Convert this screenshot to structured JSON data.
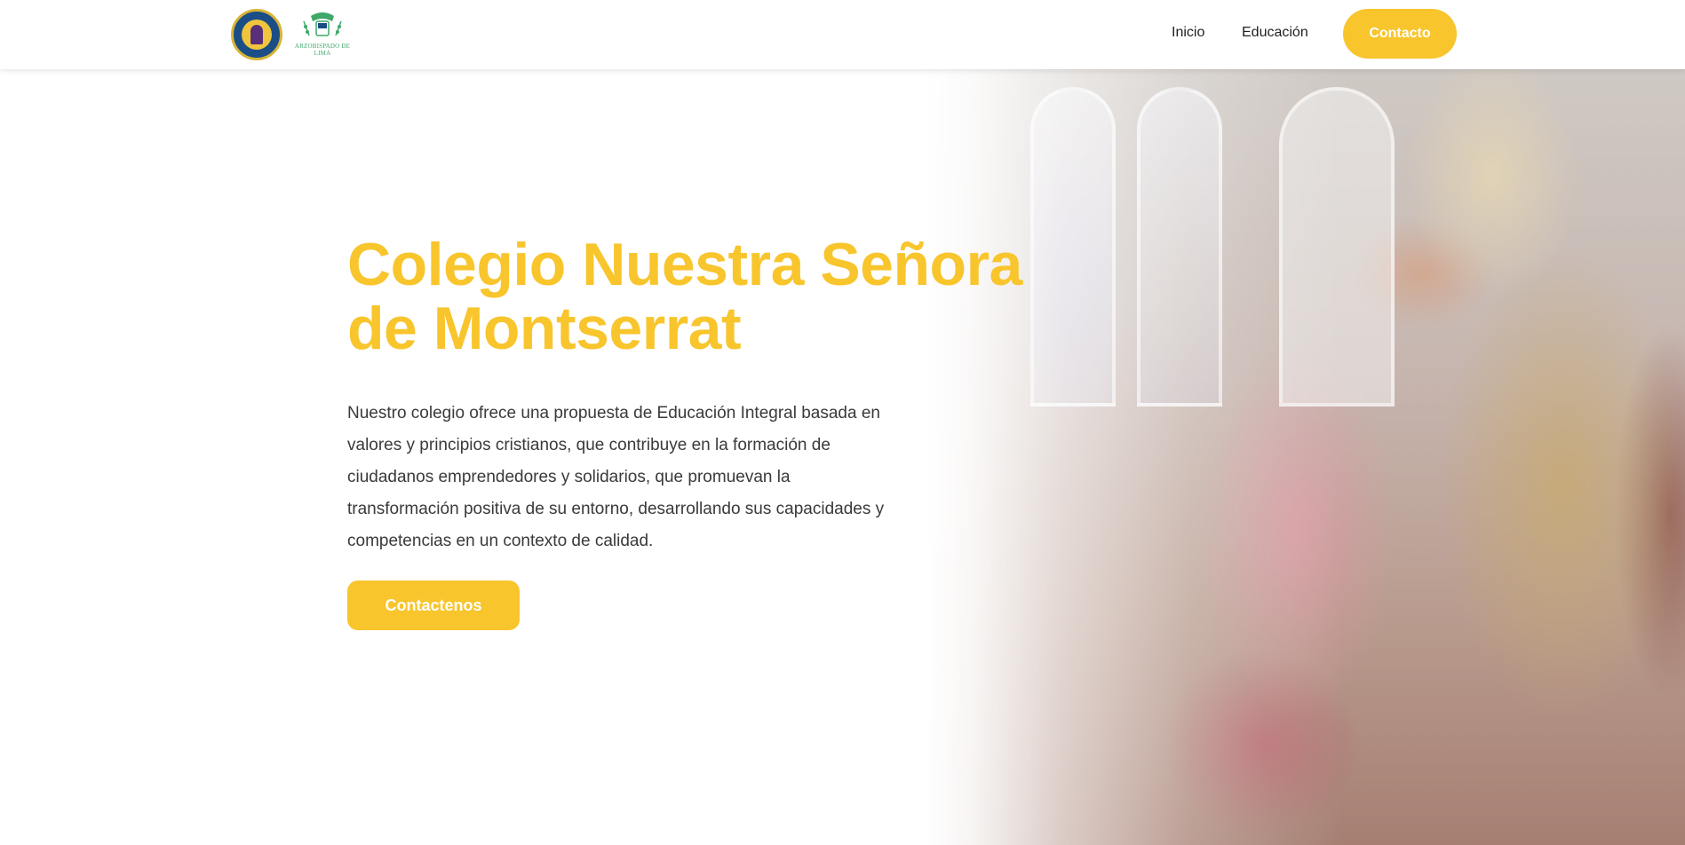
{
  "header": {
    "logo_school_alt": "Colegio Nuestra Señora de Montserrat logo",
    "logo_archdiocese_text": "ARZOBISPADO DE LIMA",
    "nav": {
      "inicio": "Inicio",
      "educacion": "Educación",
      "contacto": "Contacto"
    }
  },
  "hero": {
    "title_line1": "Colegio Nuestra Señora",
    "title_line2": "de Montserrat",
    "description": "Nuestro colegio ofrece una propuesta de Educación Integral basada en valores y principios cristianos, que contribuye en la formación de ciudadanos emprendedores y solidarios, que promuevan la transformación positiva de su entorno, desarrollando sus capacidades y competencias en un contexto de calidad.",
    "cta_label": "Contactenos"
  },
  "colors": {
    "accent": "#f8c52d",
    "text": "#3a3a3a",
    "school_logo_blue": "#1b4e86",
    "archdiocese_green": "#3fa86a"
  },
  "icons": {
    "school_logo": "school-crest-icon",
    "archdiocese_logo": "archdiocese-crest-icon"
  }
}
